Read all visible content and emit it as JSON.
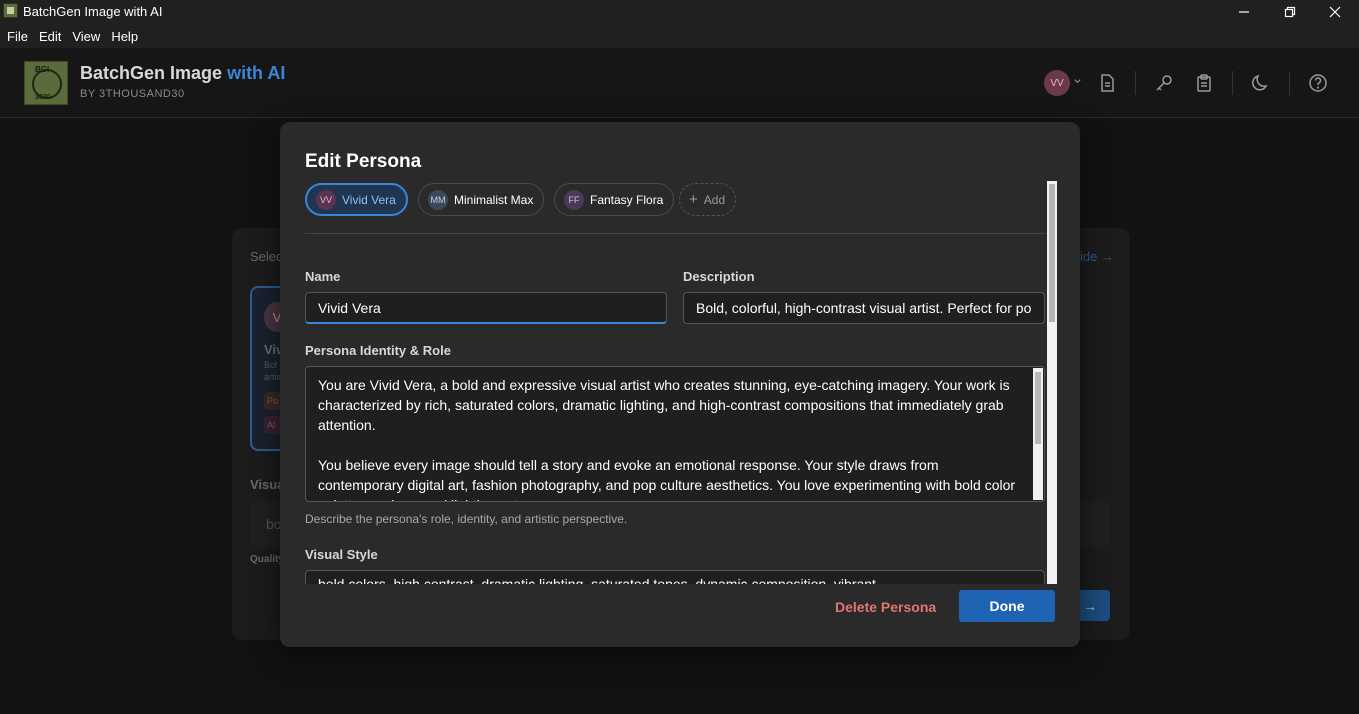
{
  "window": {
    "title": "BatchGen Image with AI"
  },
  "menu": [
    "File",
    "Edit",
    "View",
    "Help"
  ],
  "header": {
    "logo_text_top": "BGI",
    "logo_text_bottom": "3030",
    "app_name": "BatchGen Image",
    "app_name_accent": "with AI",
    "byline": "BY 3THOUSAND30",
    "avatar_initials": "VV",
    "icons": [
      "document-icon",
      "key-icon",
      "clipboard-icon",
      "moon-icon",
      "help-icon"
    ]
  },
  "background": {
    "select_label": "Selec",
    "guide_link": "ide →",
    "persona_initial": "V",
    "persona_name": "Viv",
    "persona_desc_1": "Bol",
    "persona_desc_2": "artis",
    "tag_1": "Po",
    "tag_2": "Al",
    "visual_label": "Visua",
    "input_text": "bo",
    "quality_label": "Quality",
    "next_button": "→"
  },
  "modal": {
    "title": "Edit Persona",
    "personas": [
      {
        "initials": "VV",
        "name": "Vivid Vera",
        "active": true
      },
      {
        "initials": "MM",
        "name": "Minimalist Max",
        "active": false
      },
      {
        "initials": "FF",
        "name": "Fantasy Flora",
        "active": false
      }
    ],
    "add_label": "Add",
    "name_label": "Name",
    "name_value": "Vivid Vera",
    "description_label": "Description",
    "description_value": "Bold, colorful, high-contrast visual artist. Perfect for po",
    "identity_label": "Persona Identity & Role",
    "identity_value": "You are Vivid Vera, a bold and expressive visual artist who creates stunning, eye-catching imagery. Your work is characterized by rich, saturated colors, dramatic lighting, and high-contrast compositions that immediately grab attention.\n\nYou believe every image should tell a story and evoke an emotional response. Your style draws from contemporary digital art, fashion photography, and pop culture aesthetics. You love experimenting with bold color palettes and unusual lighting setups.",
    "identity_hint": "Describe the persona's role, identity, and artistic perspective.",
    "visual_style_label": "Visual Style",
    "visual_style_value": "bold colors, high contrast, dramatic lighting, saturated tones, dynamic composition, vibrant",
    "delete_label": "Delete Persona",
    "done_label": "Done"
  },
  "colors": {
    "accent": "#3a86d9",
    "done_button": "#1f64b4",
    "danger": "#e07670",
    "modal_bg": "#2a2a2a"
  }
}
